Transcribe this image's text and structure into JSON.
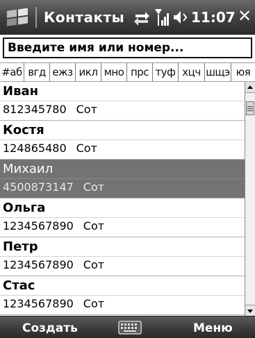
{
  "titlebar": {
    "title": "Контакты",
    "time": "11:07",
    "close_label": "✕"
  },
  "search": {
    "placeholder": "Введите имя или номер..."
  },
  "tabs": [
    "#аб",
    "вгд",
    "ежз",
    "икл",
    "мно",
    "прс",
    "туф",
    "хцч",
    "шщэ",
    "юя"
  ],
  "contacts": [
    {
      "name": "Иван",
      "number": "812345780",
      "type": "Сот"
    },
    {
      "name": "Костя",
      "number": "124865480",
      "type": "Сот"
    },
    {
      "name": "Михаил",
      "number": "4500873147",
      "type": "Сот"
    },
    {
      "name": "Ольга",
      "number": "1234567890",
      "type": "Сот"
    },
    {
      "name": "Петр",
      "number": "1234567890",
      "type": "Сот"
    },
    {
      "name": "Стас",
      "number": "1234567890",
      "type": "Сот"
    }
  ],
  "selected_contact": "Михаил",
  "softkeys": {
    "left": "Создать",
    "right": "Меню"
  },
  "icons": {
    "start": "windows-flag-icon",
    "connectivity": "connectivity-arrows-icon",
    "signal": "signal-strength-icon",
    "volume": "speaker-volume-icon",
    "keyboard": "keyboard-icon"
  }
}
